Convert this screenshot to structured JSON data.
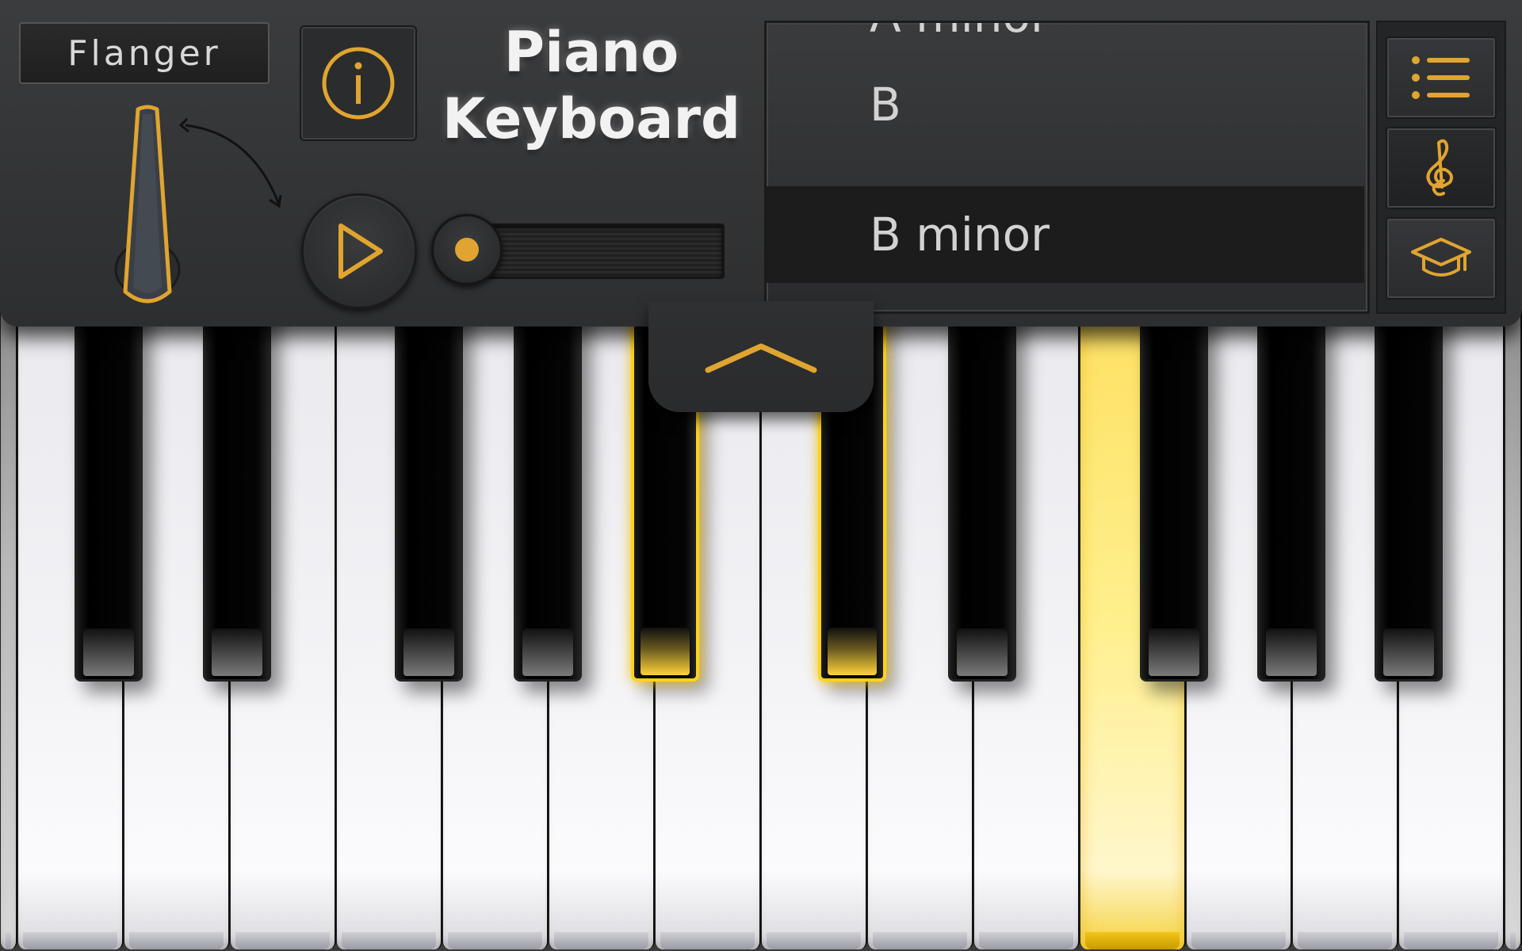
{
  "app": {
    "title_line1": "Piano",
    "title_line2": "Keyboard"
  },
  "effect": {
    "label": "Flanger"
  },
  "songs": {
    "items": [
      {
        "label": "A minor",
        "selected": false
      },
      {
        "label": "B",
        "selected": false
      },
      {
        "label": "B minor",
        "selected": true
      }
    ]
  },
  "side_menu": {
    "items": [
      {
        "icon": "list-icon",
        "active": false
      },
      {
        "icon": "treble-clef-icon",
        "active": true
      },
      {
        "icon": "graduation-cap-icon",
        "active": false
      }
    ]
  },
  "controls": {
    "info_icon": "info-icon",
    "play_icon": "play-icon",
    "collapse_icon": "chevron-up-icon"
  },
  "keyboard": {
    "highlighted_black_keys": [
      5,
      6
    ],
    "highlighted_white_keys": [
      11
    ]
  },
  "colors": {
    "accent": "#e0a530",
    "highlight": "#ffd21c",
    "panel": "#333436",
    "list_selected_bg": "#1c1c1c"
  }
}
